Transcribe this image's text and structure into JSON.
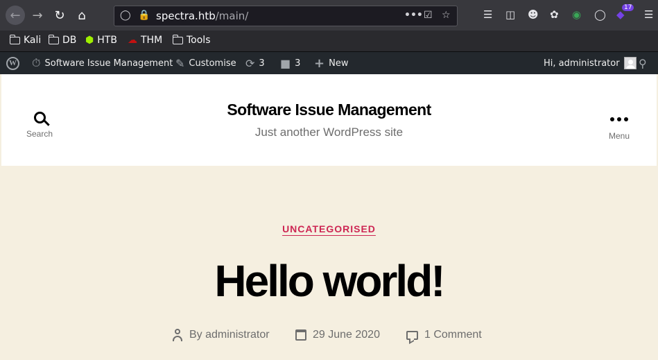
{
  "browser": {
    "url_host": "spectra.htb",
    "url_path": "/main/",
    "notification_badge": "17",
    "bookmarks": [
      {
        "label": "Kali",
        "icon": "folder-icon"
      },
      {
        "label": "DB",
        "icon": "folder-icon"
      },
      {
        "label": "HTB",
        "icon": "htb-cube-icon"
      },
      {
        "label": "THM",
        "icon": "thm-icon"
      },
      {
        "label": "Tools",
        "icon": "folder-icon"
      }
    ]
  },
  "adminbar": {
    "site_name": "Software Issue Management",
    "customise": "Customise",
    "updates_count": "3",
    "comments_count": "3",
    "new_label": "New",
    "greeting": "Hi, administrator"
  },
  "header": {
    "site_title": "Software Issue Management",
    "site_description": "Just another WordPress site",
    "search_label": "Search",
    "menu_label": "Menu"
  },
  "post": {
    "category": "UNCATEGORISED",
    "title": "Hello world!",
    "author": "By administrator",
    "date": "29 June 2020",
    "comments": "1 Comment"
  },
  "colors": {
    "accent": "#cd2653",
    "background": "#f5efe0",
    "adminbar": "#23282d"
  }
}
